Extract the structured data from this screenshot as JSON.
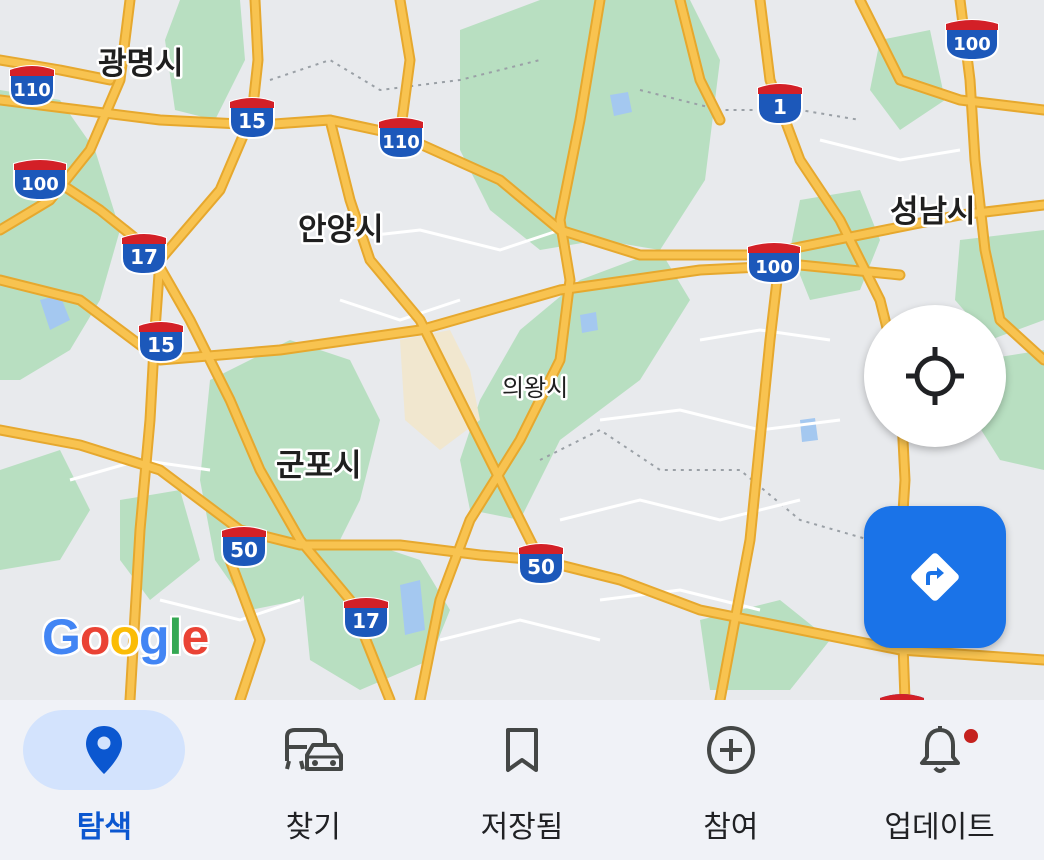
{
  "map": {
    "city_labels": [
      "광명시",
      "안양시",
      "성남시",
      "의왕시",
      "군포시"
    ],
    "highway_shields": [
      "110",
      "15",
      "110",
      "1",
      "100",
      "100",
      "17",
      "100",
      "15",
      "50",
      "50",
      "17"
    ],
    "attribution": "Google",
    "colors": {
      "land": "#e8eaed",
      "park": "#b8dfc1",
      "road": "#f8c350",
      "road_casing": "#e6a82e",
      "shield_blue": "#1c58ba",
      "shield_red": "#d32027",
      "water": "#a4c8f0"
    }
  },
  "controls": {
    "locate_icon": "crosshair-icon",
    "directions_icon": "directions-icon",
    "accent": "#1a73e8"
  },
  "nav": {
    "items": [
      {
        "label": "탐색",
        "icon": "location-pin-icon",
        "active": true
      },
      {
        "label": "찾기",
        "icon": "commute-icon",
        "active": false
      },
      {
        "label": "저장됨",
        "icon": "bookmark-icon",
        "active": false
      },
      {
        "label": "참여",
        "icon": "add-circle-icon",
        "active": false
      },
      {
        "label": "업데이트",
        "icon": "bell-icon",
        "active": false
      }
    ]
  }
}
